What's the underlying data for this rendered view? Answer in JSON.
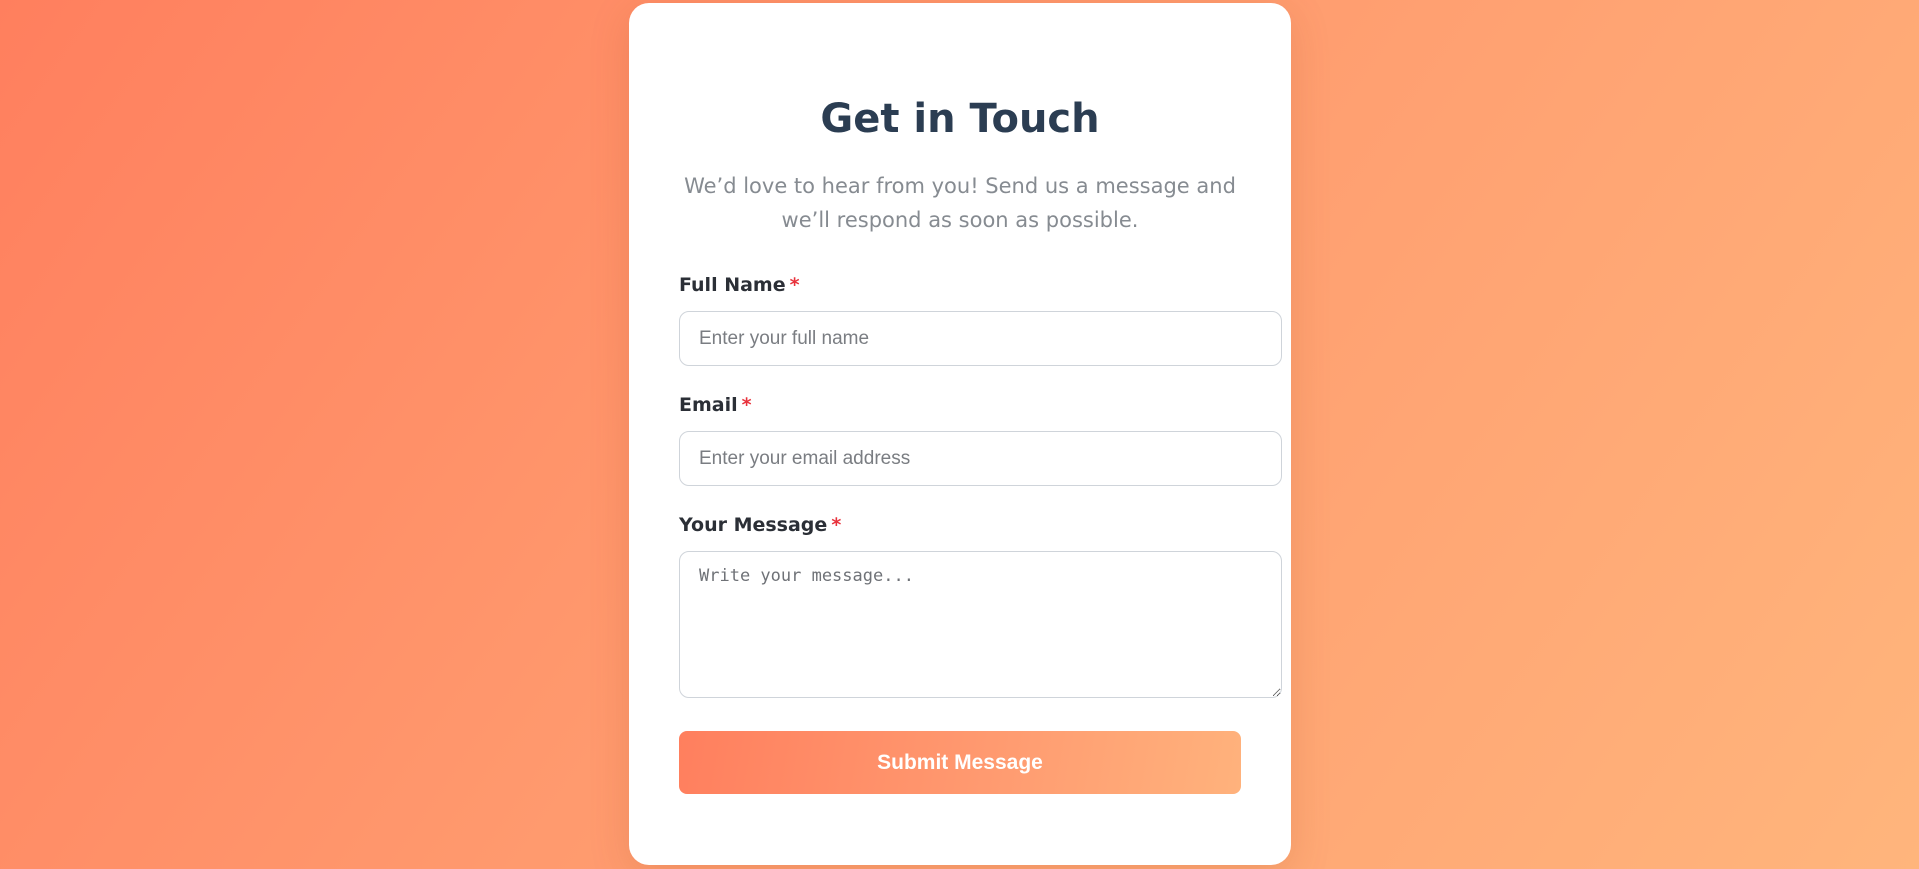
{
  "form": {
    "title": "Get in Touch",
    "subtitle": "We’d love to hear from you! Send us a message and we’ll respond as soon as possible.",
    "required_marker": "*",
    "fields": {
      "name": {
        "label": "Full Name",
        "value": "",
        "placeholder": "Enter your full name"
      },
      "email": {
        "label": "Email",
        "value": "",
        "placeholder": "Enter your email address"
      },
      "message": {
        "label": "Your Message",
        "value": "",
        "placeholder": "Write your message..."
      }
    },
    "submit_label": "Submit Message"
  },
  "colors": {
    "background_start": "#ff7f5e",
    "background_end": "#ffb57c",
    "title": "#2b3d52",
    "subtitle": "#868b91",
    "required": "#e8323c",
    "button_text": "#ffffff"
  }
}
